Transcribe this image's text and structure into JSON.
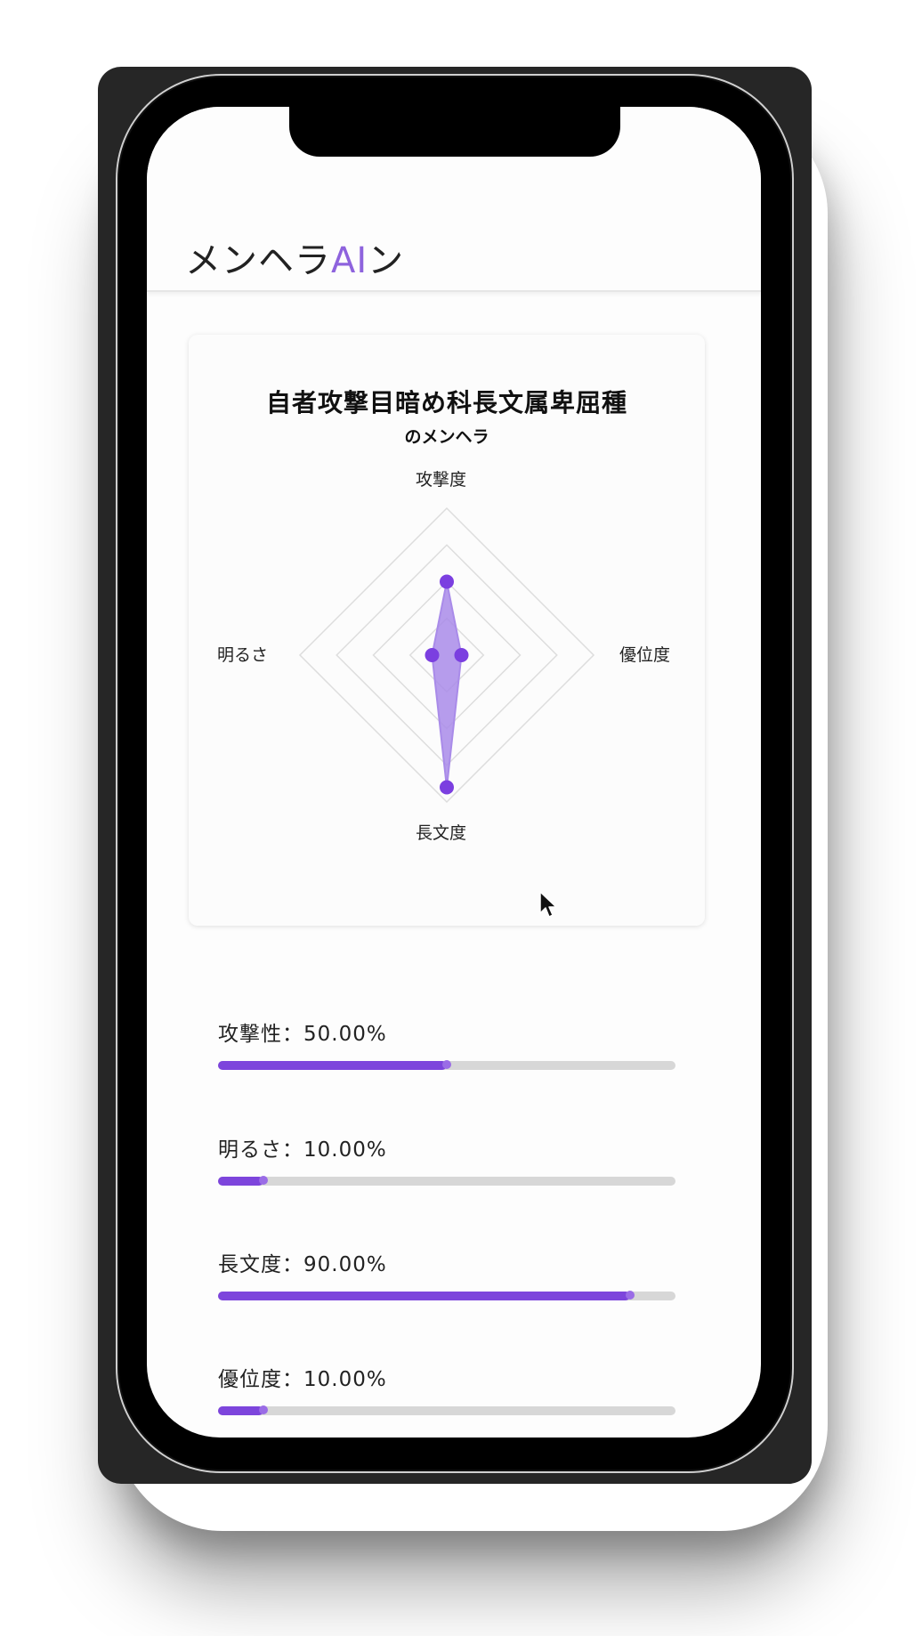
{
  "app": {
    "title_prefix": "メンヘラ",
    "title_accent": "AI",
    "title_suffix": "ン"
  },
  "result": {
    "type_name": "自者攻撃目暗め科長文属卑屈種",
    "type_suffix": "のメンヘラ"
  },
  "chart_data": {
    "type": "radar",
    "axes": [
      "攻撃度",
      "優位度",
      "長文度",
      "明るさ"
    ],
    "values": [
      50,
      10,
      90,
      10
    ],
    "range": [
      0,
      100
    ],
    "grid_levels": 4,
    "colors": {
      "fill": "#a98be9",
      "point": "#7b3fe0",
      "grid": "#dddddd"
    }
  },
  "stats": [
    {
      "label": "攻撃性：50.00%",
      "value": 50
    },
    {
      "label": "明るさ：10.00%",
      "value": 10
    },
    {
      "label": "長文度：90.00%",
      "value": 90
    },
    {
      "label": "優位度：10.00%",
      "value": 10
    }
  ],
  "colors": {
    "accent": "#8e63dd",
    "bar": "#7d45dc",
    "track": "#d7d7d7"
  },
  "icons": {
    "cursor": "mouse-pointer-icon"
  }
}
